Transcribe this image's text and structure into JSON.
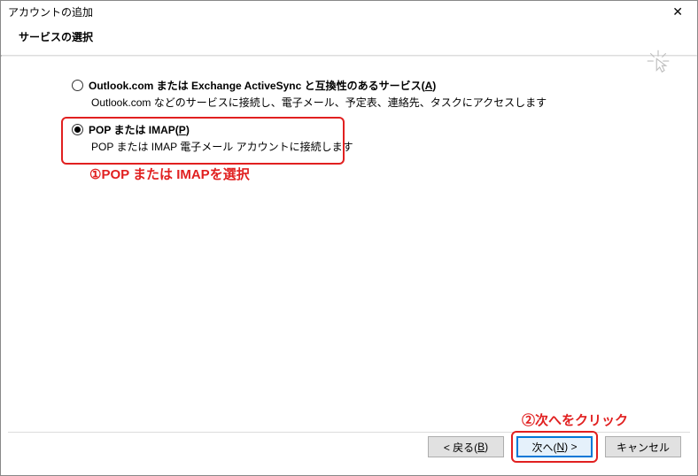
{
  "window": {
    "title": "アカウントの追加",
    "close": "✕"
  },
  "header": {
    "title": "サービスの選択"
  },
  "options": {
    "eas": {
      "label_pre": "Outlook.com または Exchange ActiveSync と互換性のあるサービス(",
      "accel": "A",
      "label_post": ")",
      "desc": "Outlook.com などのサービスに接続し、電子メール、予定表、連絡先、タスクにアクセスします"
    },
    "pop": {
      "label_pre": "POP または IMAP(",
      "accel": "P",
      "label_post": ")",
      "desc": "POP または IMAP 電子メール アカウントに接続します"
    }
  },
  "annotations": {
    "a1": "①POP または IMAPを選択",
    "a2": "②次へをクリック"
  },
  "buttons": {
    "back_pre": "< 戻る(",
    "back_accel": "B",
    "back_post": ")",
    "next_pre": "次へ(",
    "next_accel": "N",
    "next_post": ") >",
    "cancel": "キャンセル"
  }
}
